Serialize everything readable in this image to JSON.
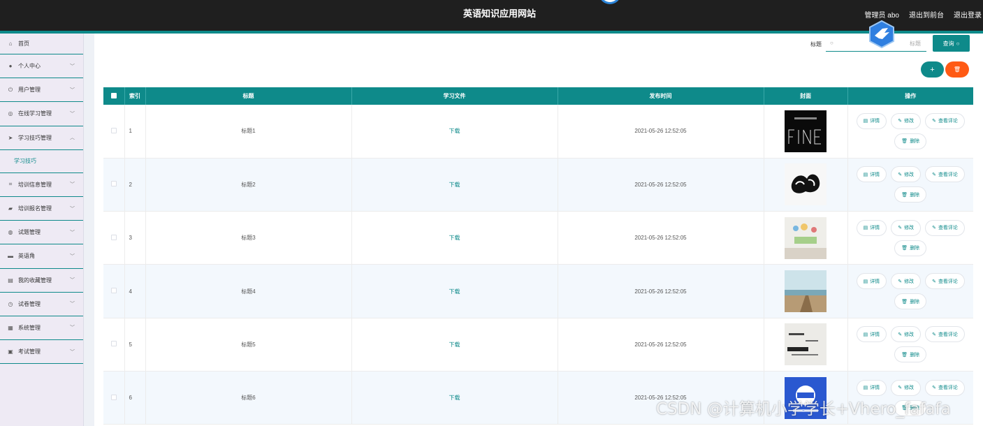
{
  "header": {
    "title": "英语知识应用网站",
    "admin": "管理员 abo",
    "back_frontend": "退出到前台",
    "logout": "退出登录"
  },
  "sidebar": {
    "items": [
      {
        "label": "首页",
        "icon": "home-icon"
      },
      {
        "label": "个人中心",
        "icon": "user-icon"
      },
      {
        "label": "用户管理",
        "icon": "power-icon"
      },
      {
        "label": "在线学习管理",
        "icon": "compass-icon"
      },
      {
        "label": "学习技巧管理",
        "icon": "send-icon",
        "expanded": true,
        "sub": "学习技巧"
      },
      {
        "label": "培训信息管理",
        "icon": "crop-icon"
      },
      {
        "label": "培训报名管理",
        "icon": "message-icon"
      },
      {
        "label": "试题管理",
        "icon": "globe-icon"
      },
      {
        "label": "英语角",
        "icon": "briefcase-icon"
      },
      {
        "label": "我的收藏管理",
        "icon": "printer-icon"
      },
      {
        "label": "试卷管理",
        "icon": "clock-icon"
      },
      {
        "label": "系统管理",
        "icon": "box-icon"
      },
      {
        "label": "考试管理",
        "icon": "clipboard-icon"
      }
    ]
  },
  "search": {
    "label": "标题",
    "placeholder": "标题",
    "button": "查询"
  },
  "actions": {
    "add": "+",
    "delete_icon": "trash-icon"
  },
  "table": {
    "headers": [
      "索引",
      "标题",
      "学习文件",
      "发布时间",
      "封面",
      "操作"
    ],
    "rows": [
      {
        "index": "1",
        "title": "标题1",
        "file": "下载",
        "time": "2021-05-26 12:52:05",
        "cover": "fine-text-image"
      },
      {
        "index": "2",
        "title": "标题2",
        "file": "下载",
        "time": "2021-05-26 12:52:05",
        "cover": "graffiti-text-image"
      },
      {
        "index": "3",
        "title": "标题3",
        "file": "下载",
        "time": "2021-05-26 12:52:05",
        "cover": "wall-decor-image"
      },
      {
        "index": "4",
        "title": "标题4",
        "file": "下载",
        "time": "2021-05-26 12:52:05",
        "cover": "beach-path-image"
      },
      {
        "index": "5",
        "title": "标题5",
        "file": "下载",
        "time": "2021-05-26 12:52:05",
        "cover": "be-happy-image"
      },
      {
        "index": "6",
        "title": "标题6",
        "file": "下载",
        "time": "2021-05-26 12:52:05",
        "cover": "blue-poster-image"
      }
    ],
    "row_actions": {
      "detail": "详情",
      "edit": "修改",
      "comments": "查看评论",
      "delete": "删除"
    }
  },
  "watermark": "CSDN @计算机小学学长+Vhero_fafafa",
  "colors": {
    "accent": "#0e8a8a",
    "danger": "#ff5a14",
    "header_bg": "#1f1f1f",
    "sidebar_bg": "#eeeaf4"
  }
}
